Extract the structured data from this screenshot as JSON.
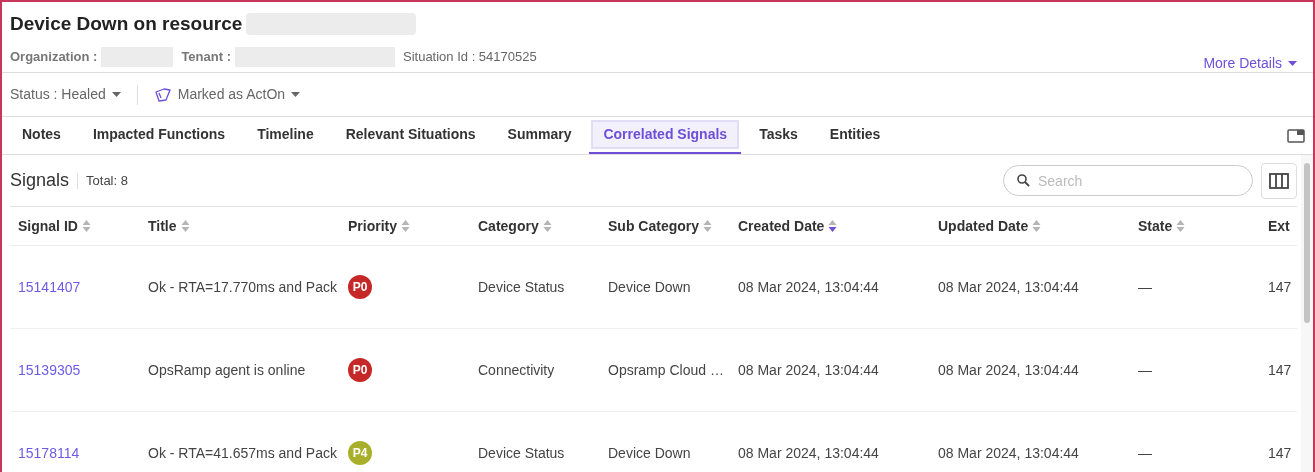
{
  "header": {
    "title": "Device Down on resource",
    "organization_label": "Organization :",
    "tenant_label": "Tenant :",
    "situation_id": "Situation Id : 54170525",
    "more_details": "More Details"
  },
  "toolbar": {
    "status": "Status : Healed",
    "marked": "Marked as ActOn"
  },
  "tabs": [
    {
      "label": "Notes",
      "selected": false
    },
    {
      "label": "Impacted Functions",
      "selected": false
    },
    {
      "label": "Timeline",
      "selected": false
    },
    {
      "label": "Relevant Situations",
      "selected": false
    },
    {
      "label": "Summary",
      "selected": false
    },
    {
      "label": "Correlated Signals",
      "selected": true
    },
    {
      "label": "Tasks",
      "selected": false
    },
    {
      "label": "Entities",
      "selected": false
    }
  ],
  "signals": {
    "title": "Signals",
    "total": "Total: 8",
    "search": {
      "placeholder": "Search"
    },
    "columns": [
      {
        "label": "Signal ID",
        "sorted_desc": false
      },
      {
        "label": "Title",
        "sorted_desc": false
      },
      {
        "label": "Priority",
        "sorted_desc": false
      },
      {
        "label": "Category",
        "sorted_desc": false
      },
      {
        "label": "Sub Category",
        "sorted_desc": false
      },
      {
        "label": "Created Date",
        "sorted_desc": true
      },
      {
        "label": "Updated Date",
        "sorted_desc": false
      },
      {
        "label": "State",
        "sorted_desc": false
      },
      {
        "label": "Ext"
      }
    ],
    "rows": [
      {
        "id": "15141407",
        "title": "Ok - RTA=17.770ms and Pack",
        "priority": "P0",
        "color": "#c62828",
        "category": "Device Status",
        "sub_category": "Device Down",
        "created": "08 Mar 2024, 13:04:44",
        "updated": "08 Mar 2024, 13:04:44",
        "state": "—",
        "column_9": "147"
      },
      {
        "id": "15139305",
        "title": "OpsRamp agent is online",
        "priority": "P0",
        "color": "#c62828",
        "category": "Connectivity",
        "sub_category": "Opsramp Cloud …",
        "created": "08 Mar 2024, 13:04:44",
        "updated": "08 Mar 2024, 13:04:44",
        "state": "—",
        "column_9": "147"
      },
      {
        "id": "15178114",
        "title": "Ok - RTA=41.657ms and Pack",
        "priority": "P4",
        "color": "#a8b02b",
        "category": "Device Status",
        "sub_category": "Device Down",
        "created": "08 Mar 2024, 13:04:44",
        "updated": "08 Mar 2024, 13:04:44",
        "state": "—",
        "column_9": "147"
      }
    ]
  }
}
